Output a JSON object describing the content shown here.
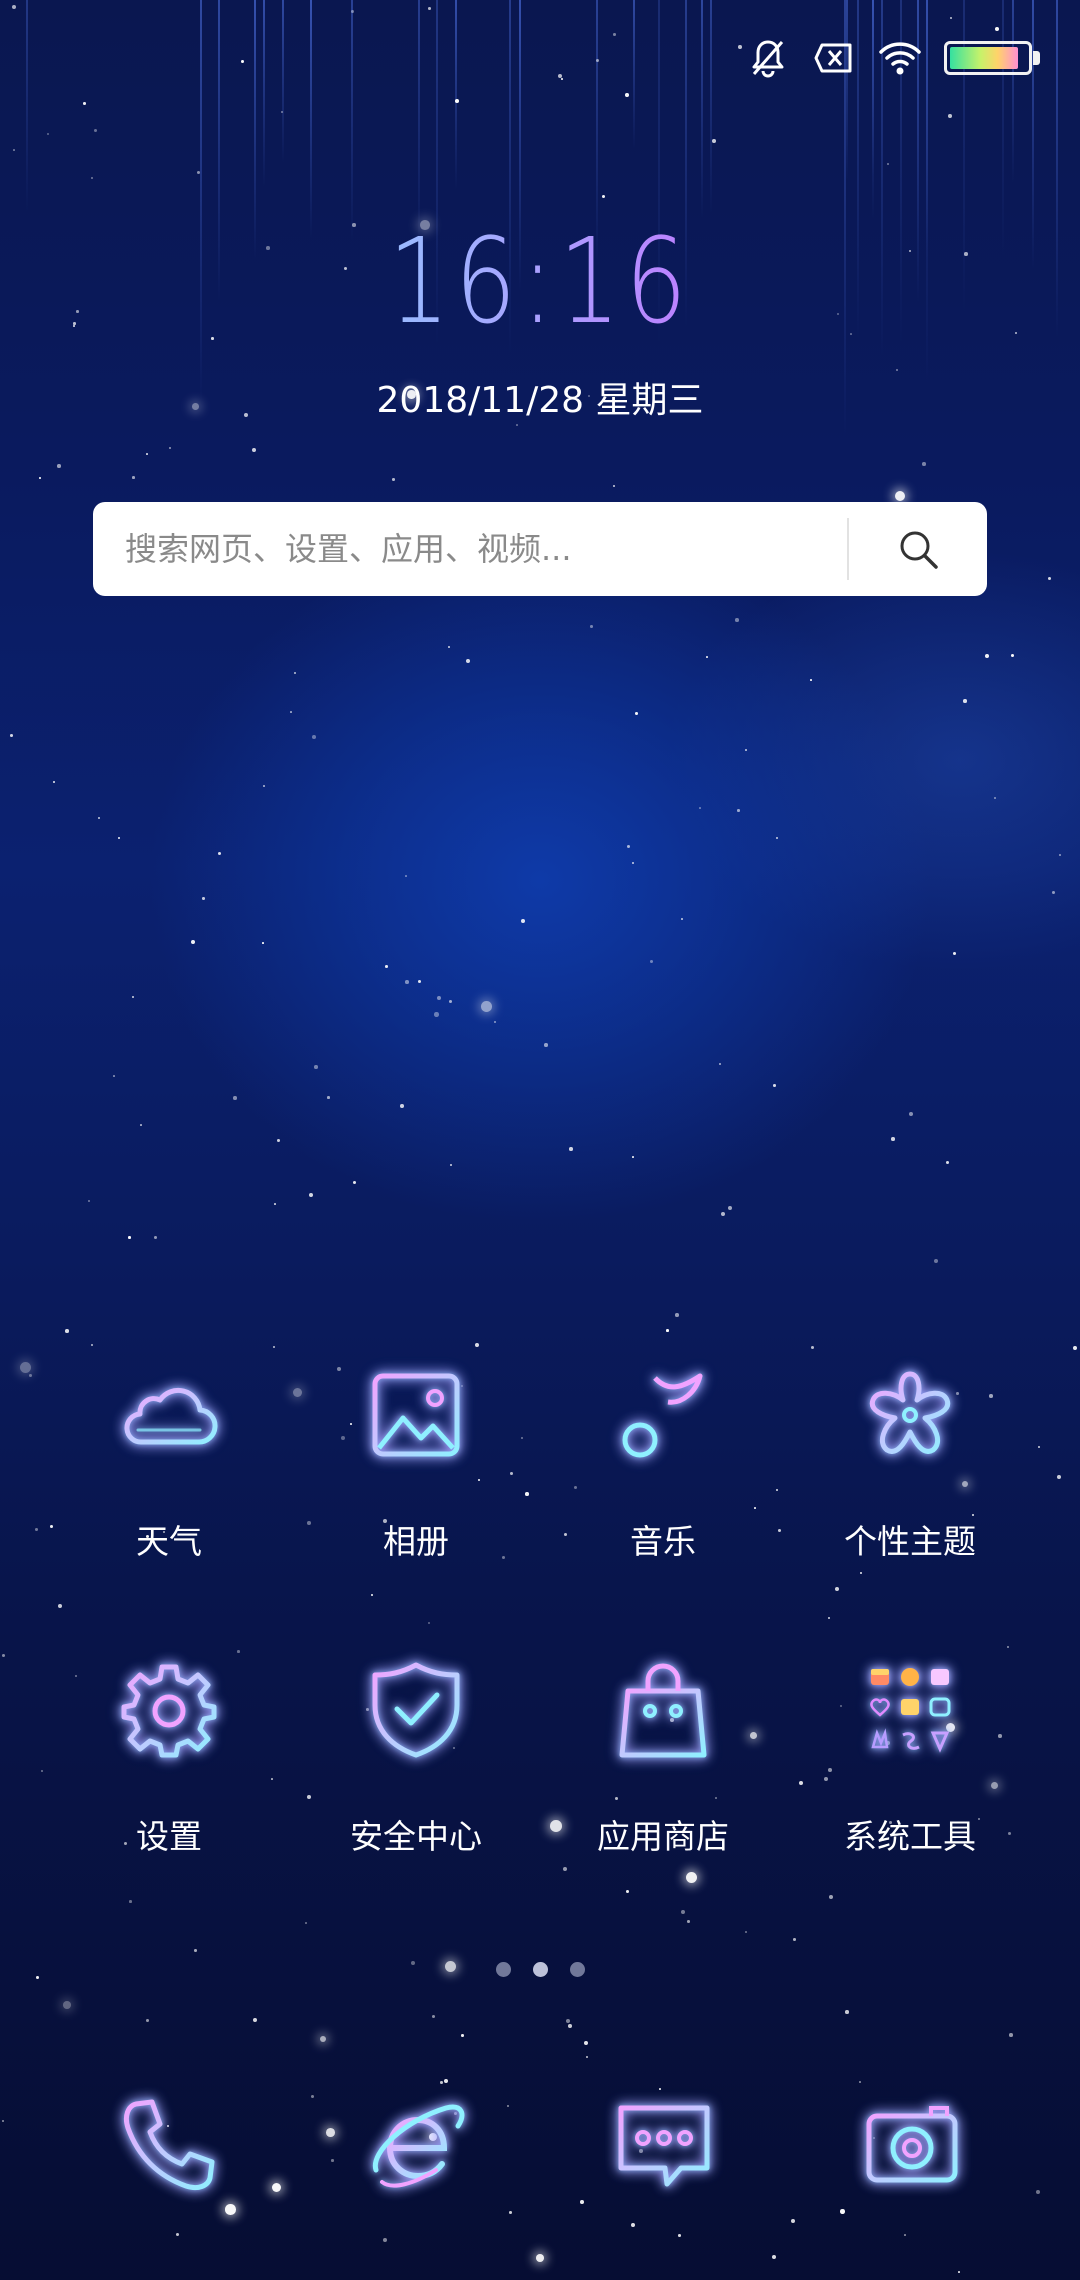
{
  "status_bar": {
    "icons": [
      "bell-off-icon",
      "sim-x-icon",
      "wifi-icon",
      "battery-icon"
    ],
    "battery_level": 0.9
  },
  "clock": {
    "time": "16:16",
    "date": "2018/11/28 星期三"
  },
  "search": {
    "placeholder": "搜索网页、设置、应用、视频...",
    "icon": "search-icon"
  },
  "apps": [
    {
      "label": "天气",
      "icon": "cloud-icon"
    },
    {
      "label": "相册",
      "icon": "photo-icon"
    },
    {
      "label": "音乐",
      "icon": "music-note-icon"
    },
    {
      "label": "个性主题",
      "icon": "flower-icon"
    },
    {
      "label": "设置",
      "icon": "gear-icon"
    },
    {
      "label": "安全中心",
      "icon": "shield-check-icon"
    },
    {
      "label": "应用商店",
      "icon": "shopping-bag-icon"
    },
    {
      "label": "系统工具",
      "icon": "folder-grid-icon"
    }
  ],
  "page_indicator": {
    "pages": 3,
    "current": 2
  },
  "dock": [
    {
      "icon": "phone-icon"
    },
    {
      "icon": "browser-icon"
    },
    {
      "icon": "message-icon"
    },
    {
      "icon": "camera-icon"
    }
  ],
  "colors": {
    "neon_pink": "#e08bff",
    "neon_cyan": "#8ff0ff",
    "background_top": "#0a1750",
    "background_bottom": "#060d33"
  }
}
